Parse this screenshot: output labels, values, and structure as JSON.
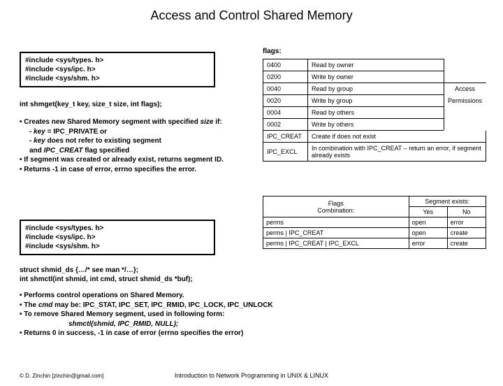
{
  "title": "Access and Control Shared Memory",
  "box1": {
    "l1": "#include <sys/types. h>",
    "l2": "#include <sys/ipc. h>",
    "l3": "#include <sys/shm. h>"
  },
  "sig1": "int shmget(key_t key, size_t size, int flags);",
  "b1": {
    "a": "• Creates new Shared Memory segment with specified ",
    "a_em": "size ",
    "a2": "if:",
    "s1a": "- ",
    "s1_em": "key",
    "s1b": " = IPC_PRIVATE                       or",
    "s2a": "- ",
    "s2_em": "key",
    "s2b": " does not refer to existing segment",
    "s3a": "  and ",
    "s3_em": "IPC_CREAT",
    "s3b": " flag specified",
    "c": "• If segment was created or already exist, returns segment ID.",
    "d": "• Returns -1 in case of error, errno specifies the error."
  },
  "flags_label": "flags:",
  "flags": [
    {
      "c": "0400",
      "d": "Read by owner"
    },
    {
      "c": "0200",
      "d": "Write by owner"
    },
    {
      "c": "0040",
      "d": "Read by group"
    },
    {
      "c": "0020",
      "d": "Write by group"
    },
    {
      "c": "0004",
      "d": "Read by others"
    },
    {
      "c": "0002",
      "d": "Write by others"
    },
    {
      "c": "IPC_CREAT",
      "d": "Create if does not exist"
    },
    {
      "c": "IPC_EXCL",
      "d": "In combination with IPC_CREAT – return an error, if segment already exists"
    }
  ],
  "side": {
    "a": "Access",
    "p": "Permissions"
  },
  "combo": {
    "h1": "Flags",
    "h1b": "Combination:",
    "h2": "Segment exists:",
    "h2a": "Yes",
    "h2b": "No",
    "rows": [
      {
        "f": "perms",
        "y": "open",
        "n": "error"
      },
      {
        "f": "perms | IPC_CREAT",
        "y": "open",
        "n": "create"
      },
      {
        "f": "perms | IPC_CREAT | IPC_EXCL",
        "y": "error",
        "n": "create"
      }
    ]
  },
  "box2": {
    "l1": "#include <sys/types. h>",
    "l2": "#include <sys/ipc. h>",
    "l3": "#include <sys/shm. h>"
  },
  "sig2a": "struct shmid_ds {…/* see man */…};",
  "sig2b": "int shmctl(int shmid, int cmd, struct shmid_ds *buf);",
  "b2": {
    "a": "• Performs control operations on Shared Memory.",
    "b1": "• The ",
    "b_em": "cmd",
    "b2": " may be: IPC_STAT, IPC_SET, IPC_RMID, IPC_LOCK, IPC_UNLOCK",
    "c": "• To remove Shared Memory segment, used in following form:",
    "c_em": "shmctl(shmid,  IPC_RMID,  NULL);",
    "d": "• Returns 0 in success, -1 in case of error (errno specifies the error)"
  },
  "footer_l": "© D. Zinchin [zinchin@gmail.com]",
  "footer_c": "Introduction to Network Programming in UNIX & LINUX"
}
